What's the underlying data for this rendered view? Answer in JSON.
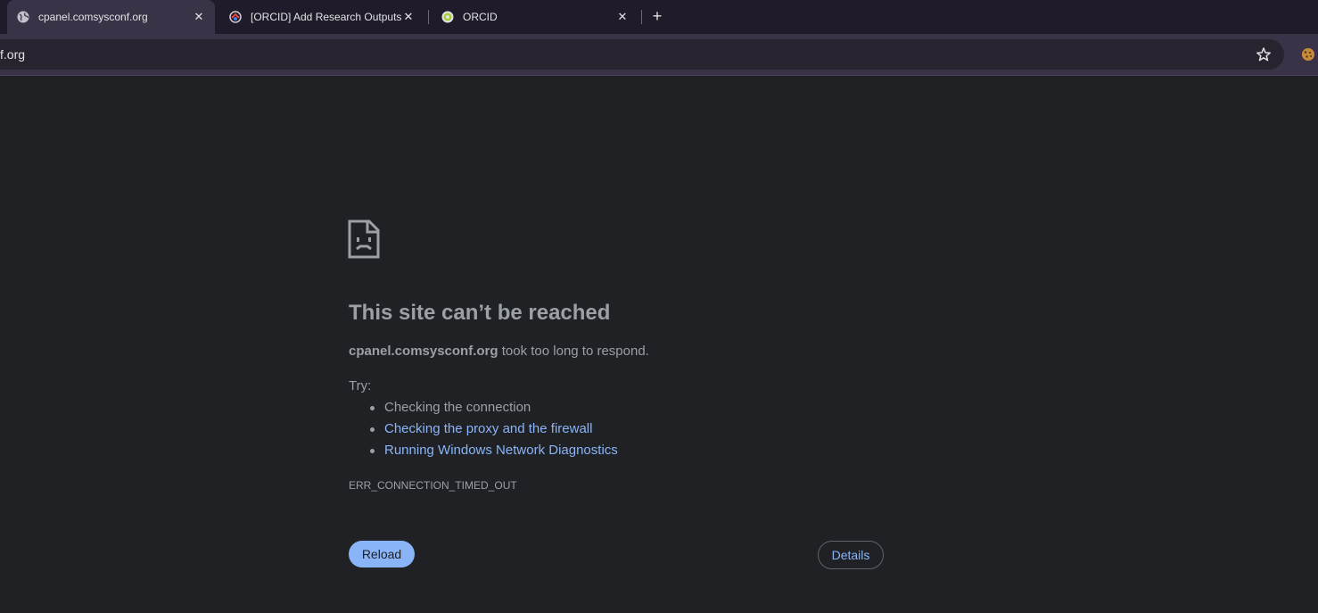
{
  "browser": {
    "tabs": [
      {
        "title": "cpanel.comsysconf.org",
        "favicon": "globe-icon",
        "active": true
      },
      {
        "title": "[ORCID] Add Research Outputs",
        "favicon": "orcid-flow-icon",
        "active": false
      },
      {
        "title": "ORCID",
        "favicon": "orcid-icon",
        "active": false
      }
    ],
    "new_tab": "+",
    "close_glyph": "✕",
    "address": "f.org",
    "bookmark_icon": "star-icon",
    "extension_icon": "cookie-icon"
  },
  "error_page": {
    "title": "This site can’t be reached",
    "host": "cpanel.comsysconf.org",
    "message": " took too long to respond.",
    "try_label": "Try:",
    "suggestions": [
      {
        "text": "Checking the connection",
        "link": false
      },
      {
        "text": "Checking the proxy and the firewall",
        "link": true
      },
      {
        "text": "Running Windows Network Diagnostics",
        "link": true
      }
    ],
    "error_code": "ERR_CONNECTION_TIMED_OUT",
    "reload_label": "Reload",
    "details_label": "Details"
  },
  "colors": {
    "page_bg": "#202124",
    "text": "#9aa0a6",
    "link": "#8ab4f8",
    "tabstrip_bg": "#1f1b2b",
    "toolbar_bg": "#3a3348"
  }
}
